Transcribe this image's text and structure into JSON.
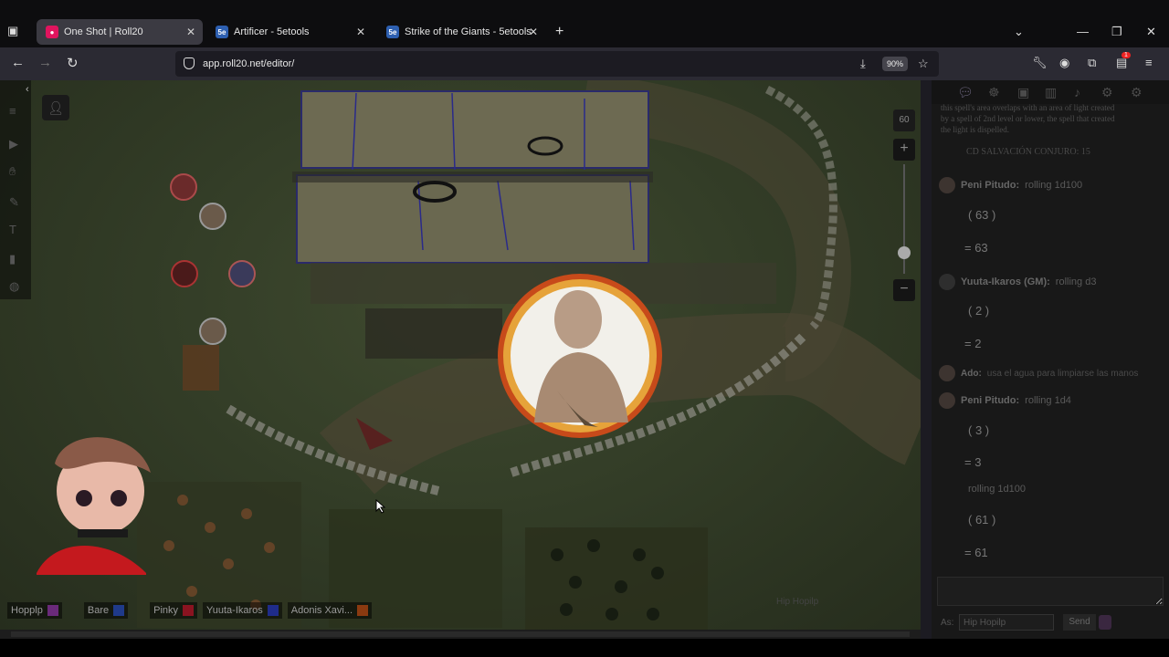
{
  "tabs": [
    {
      "title": "One Shot | Roll20",
      "favicon": "roll20",
      "active": true
    },
    {
      "title": "Artificer - 5etools",
      "favicon": "5etools",
      "active": false
    },
    {
      "title": "Strike of the Giants - 5etools",
      "favicon": "5etools",
      "active": false
    }
  ],
  "address": {
    "url": "app.roll20.net/editor/",
    "zoom": "90%"
  },
  "map": {
    "zoom_label": "60"
  },
  "players": [
    {
      "name": "Hopplp",
      "color": "#6a2a7a"
    },
    {
      "name": "Bare",
      "color": "#1f3a8a"
    },
    {
      "name": "Pinky",
      "color": "#8a1320"
    },
    {
      "name": "Yuuta-Ikaros",
      "color": "#1f2c8a"
    },
    {
      "name": "Adonis Xavi...",
      "color": "#8a3a10"
    }
  ],
  "map_watermark": "Hip Hopilp",
  "chat": {
    "spell_text": "this spell's area overlaps with an area of light created by a spell of 2nd level or lower, the spell that created the light is dispelled.",
    "save_dc": "CD SALVACIÓN CONJURO: 15",
    "rows": [
      {
        "who": "Peni Pitudo:",
        "text": "rolling 1d100",
        "result_box": "( 63 )",
        "result": "= 63"
      },
      {
        "who": "Yuuta-Ikaros (GM):",
        "text": "rolling d3",
        "result_box": "( 2 )",
        "result": "= 2"
      },
      {
        "who": "Ado:",
        "text": "usa el agua para limpiarse las manos"
      },
      {
        "who": "Peni Pitudo:",
        "text": "rolling 1d4",
        "result_box": "( 3 )",
        "result": "= 3"
      },
      {
        "who": "",
        "text": "rolling 1d100",
        "result_box": "( 61 )",
        "result": "= 61"
      }
    ],
    "as_label": "As:",
    "as_value": "Hip Hopilp",
    "send_label": "Send"
  }
}
